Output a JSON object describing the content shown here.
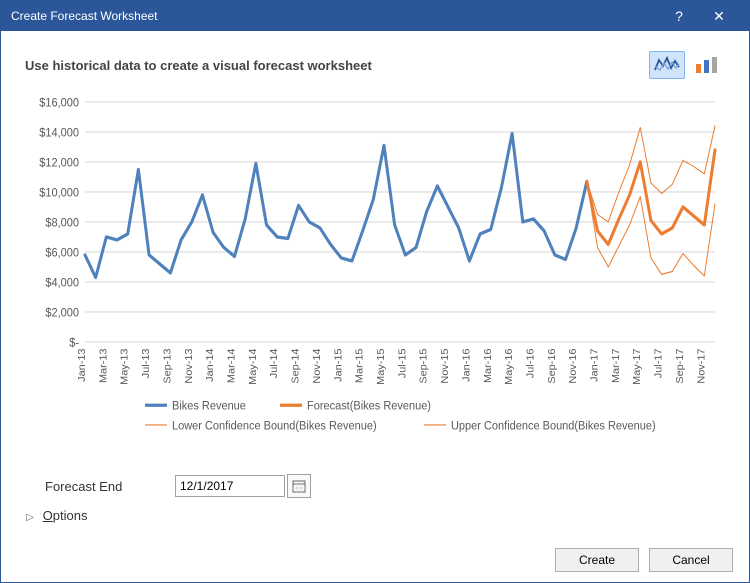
{
  "dialog": {
    "title": "Create Forecast Worksheet",
    "help_label": "?",
    "close_label": "✕"
  },
  "instruction": "Use historical data to create a visual forecast worksheet",
  "chart_type": {
    "selected": "line"
  },
  "forecast_end": {
    "label": "Forecast End",
    "value": "12/1/2017"
  },
  "options": {
    "label": "Options",
    "underline_char": "O",
    "rest": "ptions",
    "expanded": false
  },
  "buttons": {
    "create": "Create",
    "cancel": "Cancel"
  },
  "chart_data": {
    "type": "line",
    "xlabel": "",
    "ylabel": "",
    "ylim": [
      0,
      16000
    ],
    "y_ticks": [
      "$-",
      "$2,000",
      "$4,000",
      "$6,000",
      "$8,000",
      "$10,000",
      "$12,000",
      "$14,000",
      "$16,000"
    ],
    "x_ticks": [
      "Jan-13",
      "Mar-13",
      "May-13",
      "Jul-13",
      "Sep-13",
      "Nov-13",
      "Jan-14",
      "Mar-14",
      "May-14",
      "Jul-14",
      "Sep-14",
      "Nov-14",
      "Jan-15",
      "Mar-15",
      "May-15",
      "Jul-15",
      "Sep-15",
      "Nov-15",
      "Jan-16",
      "Mar-16",
      "May-16",
      "Jul-16",
      "Sep-16",
      "Nov-16",
      "Jan-17",
      "Mar-17",
      "May-17",
      "Jul-17",
      "Sep-17",
      "Nov-17"
    ],
    "x": [
      "Jan-13",
      "Feb-13",
      "Mar-13",
      "Apr-13",
      "May-13",
      "Jun-13",
      "Jul-13",
      "Aug-13",
      "Sep-13",
      "Oct-13",
      "Nov-13",
      "Dec-13",
      "Jan-14",
      "Feb-14",
      "Mar-14",
      "Apr-14",
      "May-14",
      "Jun-14",
      "Jul-14",
      "Aug-14",
      "Sep-14",
      "Oct-14",
      "Nov-14",
      "Dec-14",
      "Jan-15",
      "Feb-15",
      "Mar-15",
      "Apr-15",
      "May-15",
      "Jun-15",
      "Jul-15",
      "Aug-15",
      "Sep-15",
      "Oct-15",
      "Nov-15",
      "Dec-15",
      "Jan-16",
      "Feb-16",
      "Mar-16",
      "Apr-16",
      "May-16",
      "Jun-16",
      "Jul-16",
      "Aug-16",
      "Sep-16",
      "Oct-16",
      "Nov-16",
      "Dec-16",
      "Jan-17",
      "Feb-17",
      "Mar-17",
      "Apr-17",
      "May-17",
      "Jun-17",
      "Jul-17",
      "Aug-17",
      "Sep-17",
      "Oct-17",
      "Nov-17",
      "Dec-17"
    ],
    "series": [
      {
        "name": "Bikes Revenue",
        "role": "historical",
        "color": "#4f81bd",
        "width": 3,
        "start_index": 0,
        "values": [
          5800,
          4300,
          7000,
          6800,
          7200,
          11500,
          5800,
          5200,
          4600,
          6800,
          8000,
          9800,
          7300,
          6300,
          5700,
          8200,
          11900,
          7800,
          7000,
          6900,
          9100,
          8000,
          7600,
          6500,
          5600,
          5400,
          7400,
          9500,
          13100,
          7800,
          5800,
          6300,
          8700,
          10400,
          9000,
          7600,
          5400,
          7200,
          7500,
          10300,
          13900,
          8000,
          8200,
          7400,
          5800,
          5500,
          7600,
          10700
        ]
      },
      {
        "name": "Forecast(Bikes Revenue)",
        "role": "forecast",
        "color": "#ed7d31",
        "width": 3,
        "start_index": 47,
        "values": [
          10700,
          7400,
          6500,
          8200,
          9800,
          12000,
          8100,
          7200,
          7600,
          9000,
          8400,
          7800,
          12800
        ]
      },
      {
        "name": "Lower Confidence Bound(Bikes Revenue)",
        "role": "lower",
        "color": "#ed7d31",
        "width": 1,
        "start_index": 47,
        "values": [
          10700,
          6300,
          5000,
          6400,
          7800,
          9700,
          5600,
          4500,
          4700,
          5900,
          5100,
          4400,
          9200
        ]
      },
      {
        "name": "Upper Confidence Bound(Bikes Revenue)",
        "role": "upper",
        "color": "#ed7d31",
        "width": 1,
        "start_index": 47,
        "values": [
          10700,
          8500,
          8000,
          10000,
          11800,
          14300,
          10600,
          9900,
          10500,
          12100,
          11700,
          11200,
          14400
        ]
      }
    ],
    "legend": {
      "position": "bottom",
      "rows": [
        [
          "Bikes Revenue",
          "Forecast(Bikes Revenue)"
        ],
        [
          "Lower Confidence Bound(Bikes Revenue)",
          "Upper Confidence Bound(Bikes Revenue)"
        ]
      ]
    }
  }
}
